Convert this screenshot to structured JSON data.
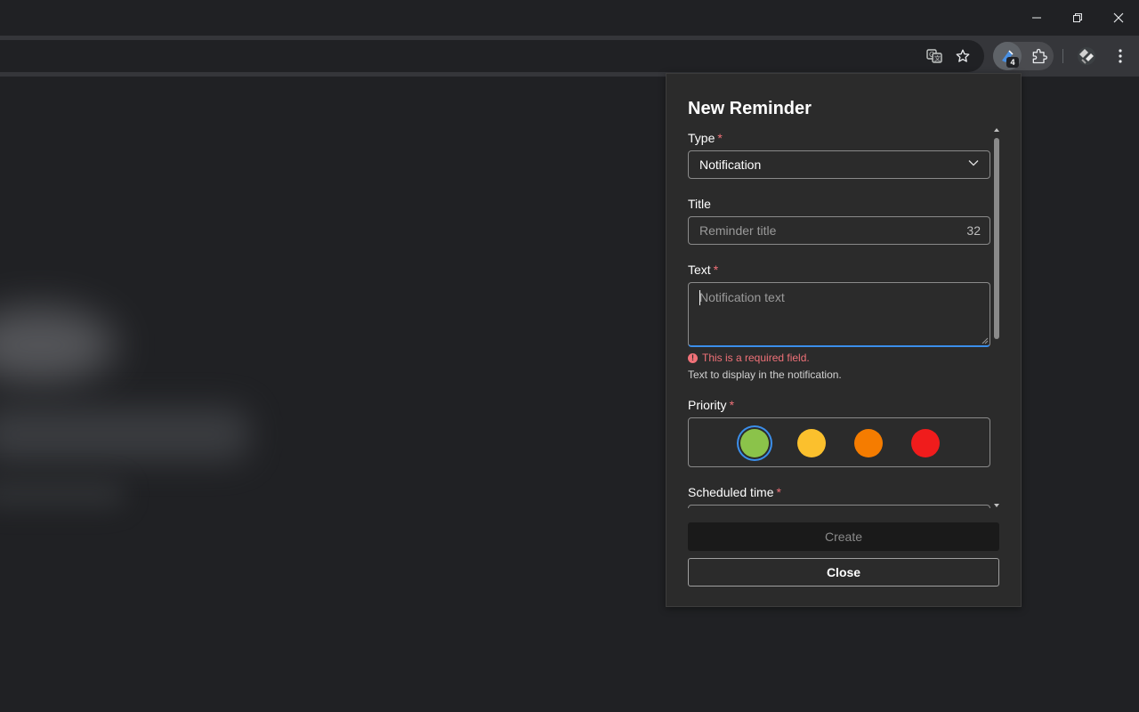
{
  "window": {
    "minimize_icon": "minimize-icon",
    "restore_icon": "restore-icon",
    "close_icon": "close-icon"
  },
  "toolbar": {
    "icons": [
      "translate-icon",
      "star-icon",
      "reminder-extension-icon",
      "puzzle-icon",
      "profile-icon",
      "more-vert-icon"
    ],
    "extension_badge": "4"
  },
  "popup": {
    "title": "New Reminder",
    "type": {
      "label": "Type",
      "required_mark": "*",
      "selected": "Notification"
    },
    "title_field": {
      "label": "Title",
      "placeholder": "Reminder title",
      "char_count": "32"
    },
    "text_field": {
      "label": "Text",
      "required_mark": "*",
      "placeholder": "Notification text",
      "error": "This is a required field.",
      "hint": "Text to display in the notification."
    },
    "priority": {
      "label": "Priority",
      "required_mark": "*",
      "options": [
        {
          "color": "#8bc34a",
          "selected": true
        },
        {
          "color": "#fbc02d",
          "selected": false
        },
        {
          "color": "#f57c00",
          "selected": false
        },
        {
          "color": "#f01c1c",
          "selected": false
        }
      ]
    },
    "scheduled_time": {
      "label": "Scheduled time",
      "required_mark": "*"
    },
    "create_label": "Create",
    "close_label": "Close"
  },
  "colors": {
    "accent": "#3b8eea",
    "error": "#f07178",
    "popup_bg": "#2b2b2b"
  }
}
